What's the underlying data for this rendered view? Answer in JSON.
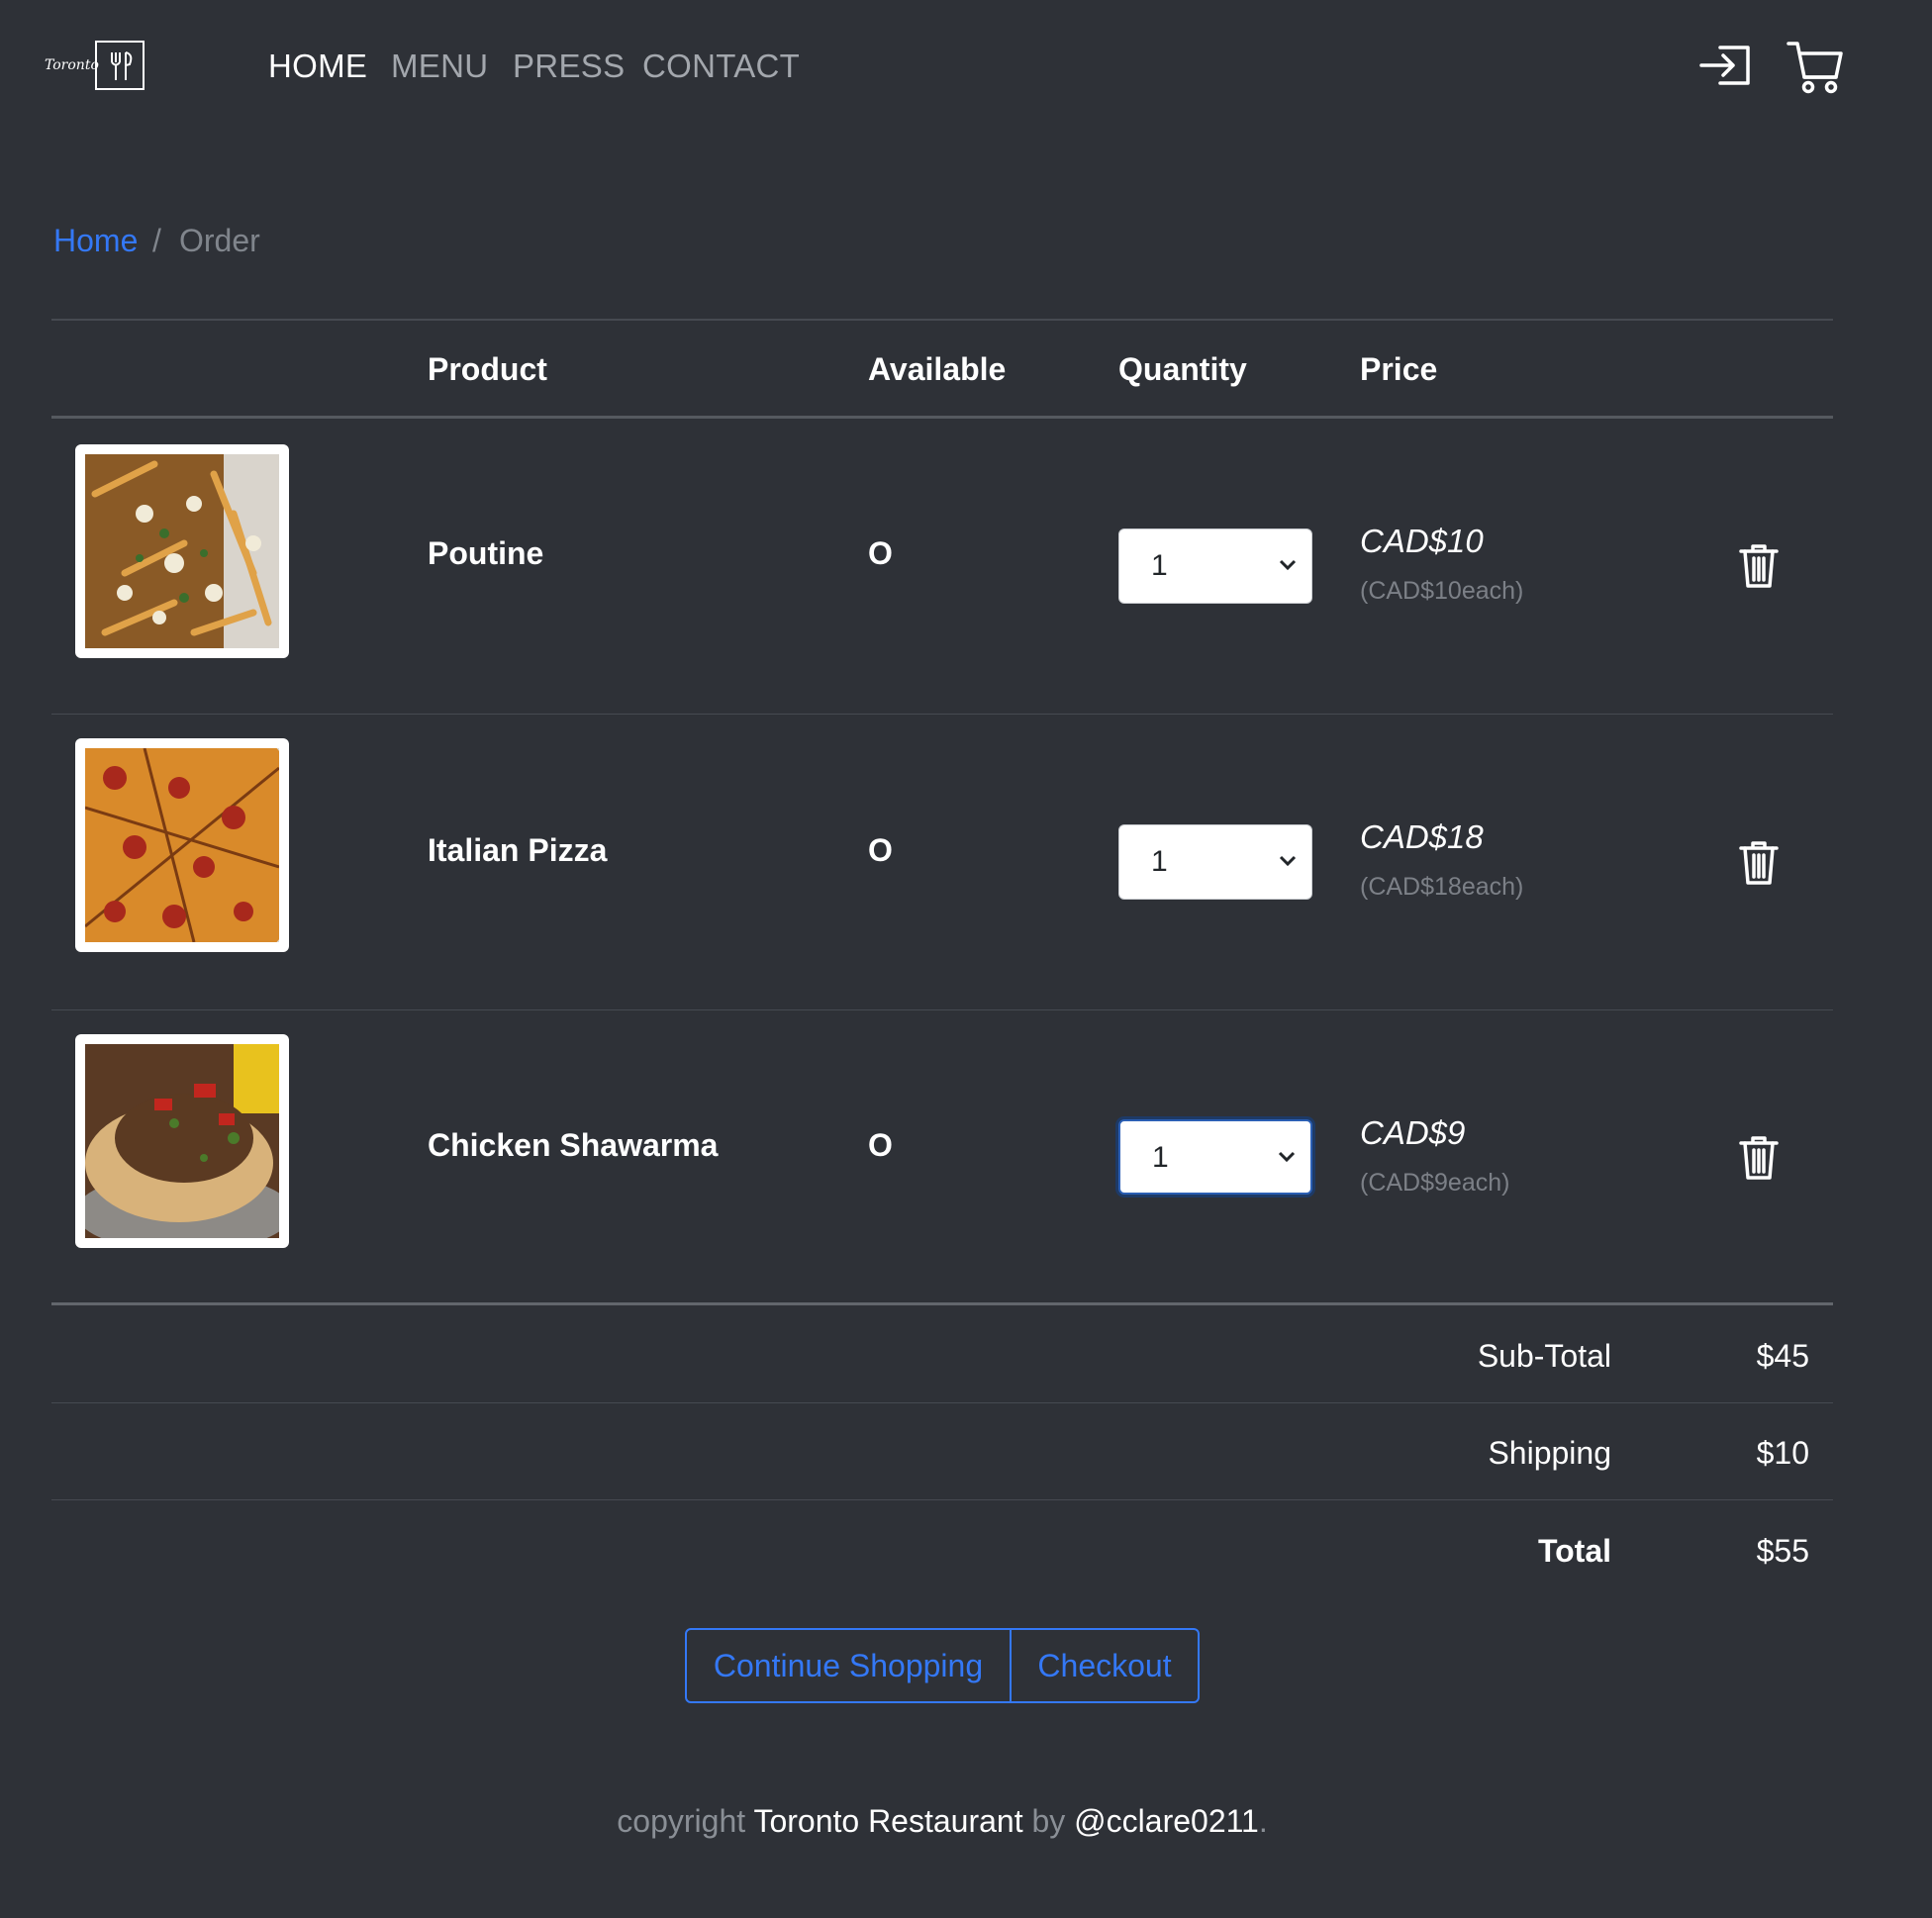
{
  "header": {
    "logo_text": "Toronto",
    "nav": [
      {
        "label": "HOME",
        "active": true
      },
      {
        "label": "MENU",
        "active": false
      },
      {
        "label": "PRESS",
        "active": false
      },
      {
        "label": "CONTACT",
        "active": false
      }
    ],
    "icons": [
      "login-icon",
      "cart-icon"
    ]
  },
  "breadcrumb": {
    "home": "Home",
    "separator": "/",
    "current": "Order"
  },
  "table": {
    "headers": {
      "product": "Product",
      "available": "Available",
      "quantity": "Quantity",
      "price": "Price"
    },
    "rows": [
      {
        "name": "Poutine",
        "available": "O",
        "quantity": "1",
        "price": "CAD$10",
        "each": "(CAD$10each)"
      },
      {
        "name": "Italian Pizza",
        "available": "O",
        "quantity": "1",
        "price": "CAD$18",
        "each": "(CAD$18each)"
      },
      {
        "name": "Chicken Shawarma",
        "available": "O",
        "quantity": "1",
        "price": "CAD$9",
        "each": "(CAD$9each)"
      }
    ]
  },
  "totals": {
    "subtotal_label": "Sub-Total",
    "subtotal_value": "$45",
    "shipping_label": "Shipping",
    "shipping_value": "$10",
    "total_label": "Total",
    "total_value": "$55"
  },
  "buttons": {
    "continue": "Continue Shopping",
    "checkout": "Checkout"
  },
  "footer": {
    "copyright": "copyright",
    "restaurant": "Toronto Restaurant",
    "by": "by",
    "handle": "@cclare0211",
    "period": "."
  },
  "colors": {
    "background": "#2e3137",
    "link": "#3478f6",
    "muted": "#80858c"
  }
}
